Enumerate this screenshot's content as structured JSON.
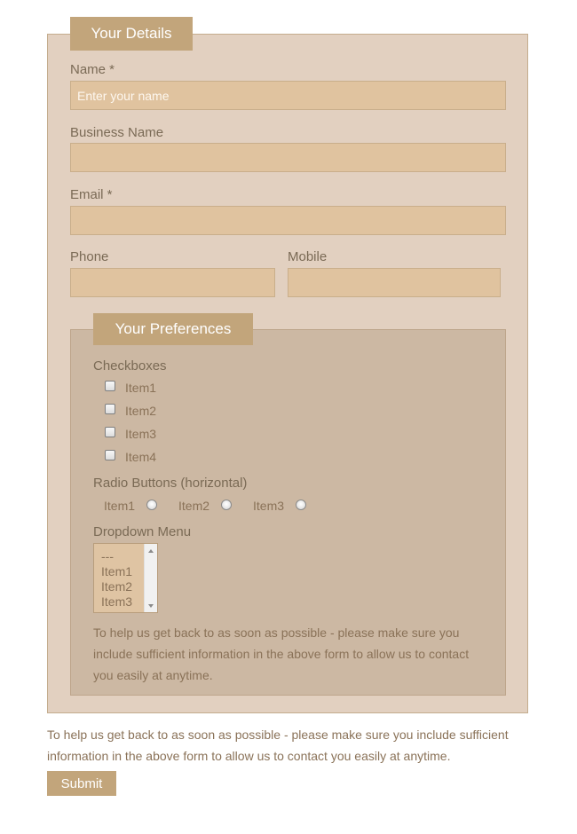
{
  "details": {
    "legend": "Your Details",
    "name_label": "Name *",
    "name_placeholder": "Enter your name",
    "business_label": "Business Name",
    "email_label": "Email *",
    "phone_label": "Phone",
    "mobile_label": "Mobile"
  },
  "preferences": {
    "legend": "Your Preferences",
    "checkboxes_label": "Checkboxes",
    "checkboxes": [
      "Item1",
      "Item2",
      "Item3",
      "Item4"
    ],
    "radio_label": "Radio Buttons (horizontal)",
    "radios": [
      "Item1",
      "Item2",
      "Item3"
    ],
    "dropdown_label": "Dropdown Menu",
    "dropdown_options": [
      "---",
      "Item1",
      "Item2",
      "Item3"
    ],
    "help_text": "To help us get back to as soon as possible - please make sure you include sufficient information in the above form to allow us to contact you easily at anytime."
  },
  "footer": {
    "help_text": "To help us get back to as soon as possible - please make sure you include sufficient information in the above form to allow us to contact you easily at anytime.",
    "submit_label": "Submit"
  },
  "colors": {
    "outer_bg": "#e2d0c0",
    "inner_bg": "#ccb8a3",
    "field_bg": "#e0c39f",
    "accent": "#c2a57b",
    "text": "#7a6a55"
  }
}
